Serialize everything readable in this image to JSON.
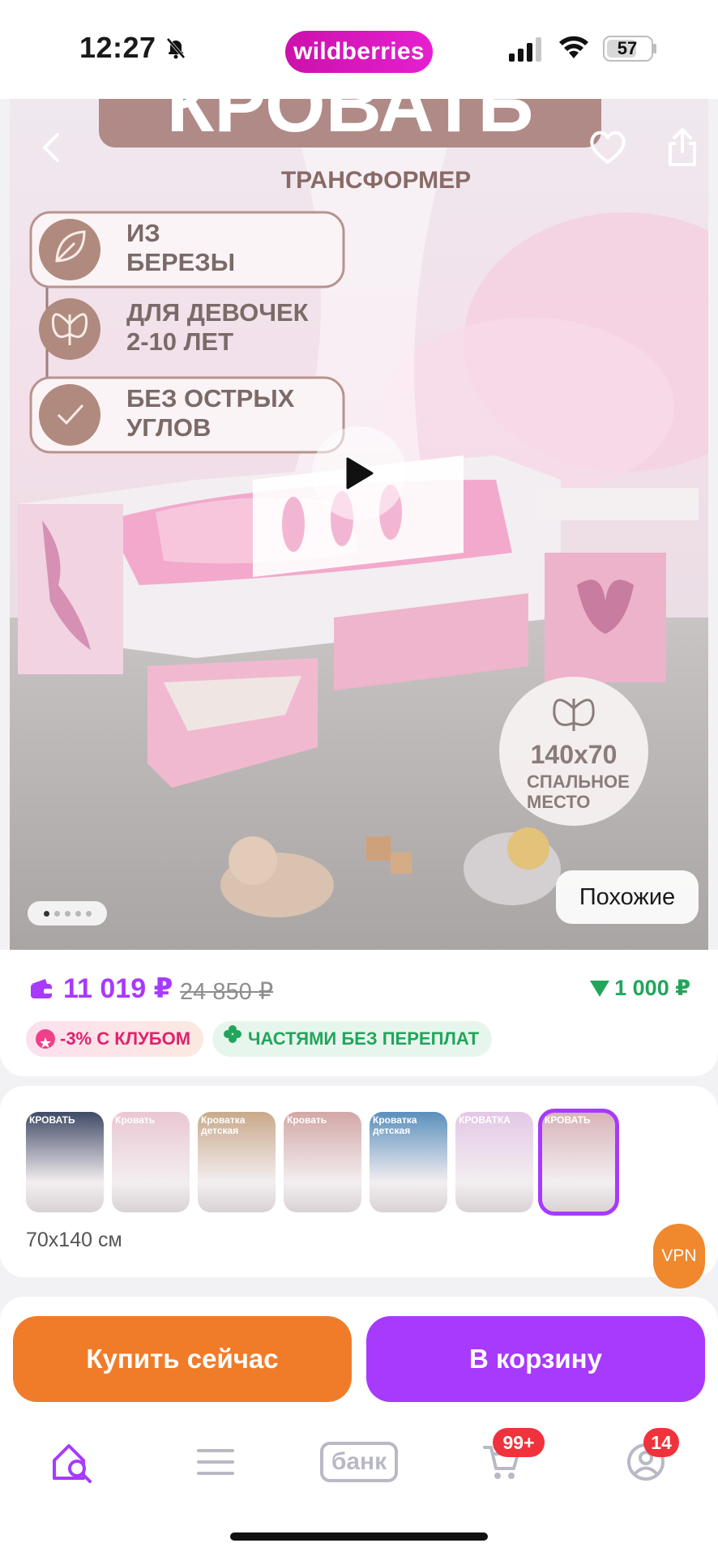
{
  "status_bar": {
    "time": "12:27",
    "brand": "wildberries",
    "battery": "57"
  },
  "hero": {
    "banner_title": "КРОВАТЬ",
    "banner_subtitle": "ТРАНСФОРМЕР",
    "features": [
      {
        "label": "ИЗ БЕРЕЗЫ",
        "icon": "leaf-icon"
      },
      {
        "label": "ДЛЯ ДЕВОЧЕК 2-10 ЛЕТ",
        "icon": "butterfly-icon"
      },
      {
        "label": "БЕЗ ОСТРЫХ УГЛОВ",
        "icon": "check-shield-icon"
      }
    ],
    "size_badge": {
      "size": "140x70",
      "caption": "СПАЛЬНОЕ МЕСТО"
    },
    "similar_button": "Похожие",
    "current_slide": 1,
    "slide_count": 5
  },
  "price": {
    "current": "11 019 ₽",
    "old": "24 850 ₽",
    "cashback": "1 000 ₽",
    "club_badge": "-3% С КЛУБОМ",
    "parts_badge": "ЧАСТЯМИ БЕЗ ПЕРЕПЛАТ"
  },
  "variants": {
    "thumbnails": [
      {
        "title": "КРОВАТЬ",
        "color": "#3f4a66"
      },
      {
        "title": "Кровать",
        "color": "#e9c7d3"
      },
      {
        "title": "Кроватка детская",
        "color": "#c9a98a"
      },
      {
        "title": "Кровать",
        "color": "#d3a7a7"
      },
      {
        "title": "Кроватка детская",
        "color": "#5a8fbd"
      },
      {
        "title": "КРОВАТКА",
        "color": "#e3c8e6"
      },
      {
        "title": "КРОВАТЬ",
        "color": "#d7b3b8"
      }
    ],
    "selected_index": 6,
    "size_label": "70x140 см"
  },
  "floating": {
    "vpn": "VPN"
  },
  "actions": {
    "buy_now": "Купить сейчас",
    "add_to_cart": "В корзину"
  },
  "tab_bar": {
    "bank": "банк",
    "cart_badge": "99+",
    "profile_badge": "14"
  },
  "colors": {
    "accent": "#a73afd",
    "brand": "#cb11ab",
    "buy": "#f07c2a",
    "cashback": "#22a55b"
  }
}
